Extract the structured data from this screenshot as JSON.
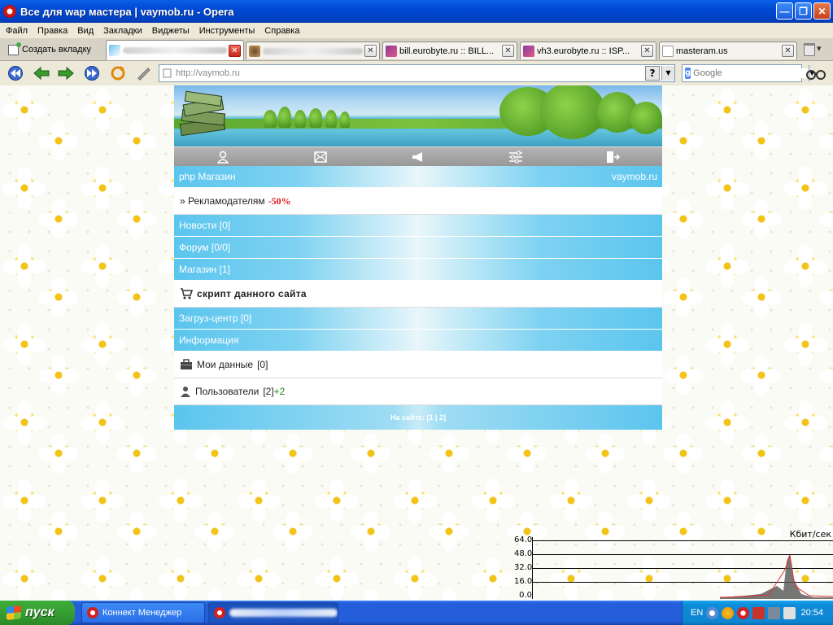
{
  "window": {
    "title": "Все для wap мастера | vaymob.ru - Opera"
  },
  "menu": [
    "Файл",
    "Правка",
    "Вид",
    "Закладки",
    "Виджеты",
    "Инструменты",
    "Справка"
  ],
  "tabs": {
    "new_tab_label": "Создать вкладку",
    "items": [
      {
        "label": "",
        "active": true
      },
      {
        "label": "",
        "active": false
      },
      {
        "label": "bill.eurobyte.ru :: BILL...",
        "active": false
      },
      {
        "label": "vh3.eurobyte.ru :: ISP...",
        "active": false
      },
      {
        "label": "masteram.us",
        "active": false
      }
    ]
  },
  "address": {
    "value": "http://vaymob.ru",
    "help_label": "?"
  },
  "search": {
    "placeholder": "Google"
  },
  "site": {
    "header": {
      "left": "php Магазин",
      "right": "vaymob.ru"
    },
    "ad_row": {
      "prefix": "» Рекламодателям",
      "discount": "-50%"
    },
    "nav1": [
      "Новости [0]",
      "Форум [0/0]",
      "Магазин [1]"
    ],
    "script_row": "скрипт данного сайта",
    "nav2": [
      "Загруз-центр [0]",
      "Информация"
    ],
    "my_data": {
      "label": "Мои данные",
      "count": "[0]"
    },
    "users": {
      "label": "Пользователи",
      "count": "[2]",
      "plus": "+2"
    },
    "footer": "На сайте: [1 | 2]"
  },
  "netmon": {
    "unit": "Кбит/сек",
    "labels": [
      "64.0",
      "48.0",
      "32.0",
      "16.0",
      "0.0"
    ]
  },
  "taskbar": {
    "start_label": "пуск",
    "tasks": [
      {
        "label": "Коннект Менеджер"
      }
    ],
    "tray_lang": "EN",
    "clock": "20:54"
  },
  "colors": {
    "accent_blue": "#5bc5ee",
    "red": "#e0161c",
    "green": "#1a8a1a",
    "xp_blue": "#245edb"
  }
}
